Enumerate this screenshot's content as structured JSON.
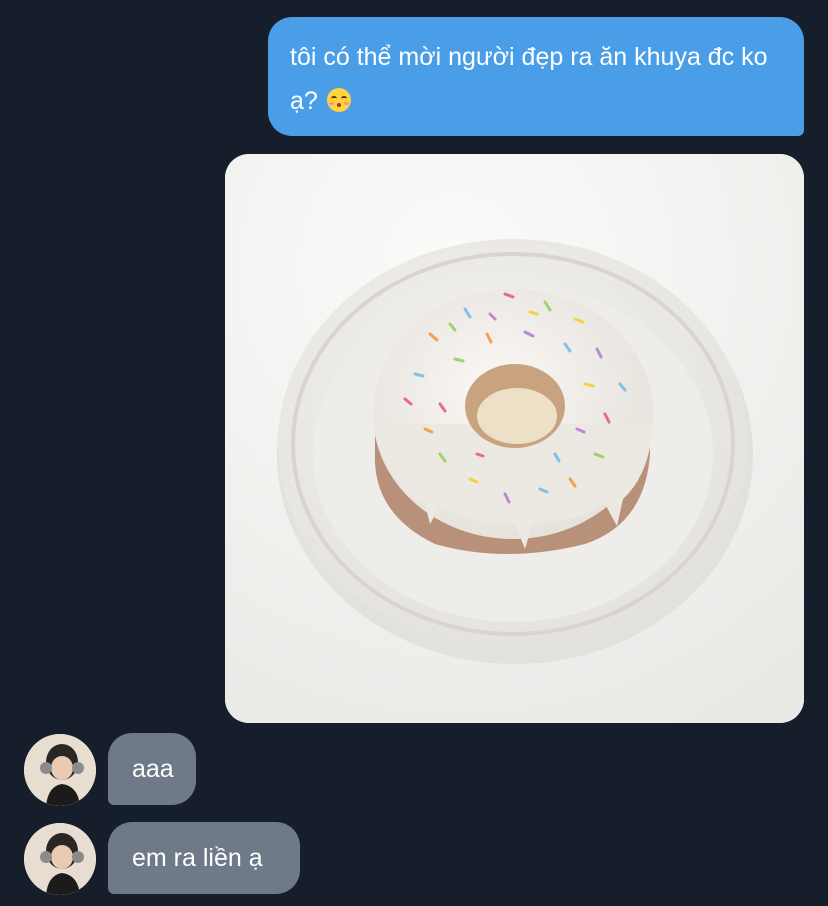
{
  "messages": {
    "outgoing_text": "tôi có thể mời người đẹp ra ăn khuya đc ko ạ?",
    "outgoing_emoji": "kissing-face-with-closed-eyes",
    "incoming": [
      {
        "text": "aaa"
      },
      {
        "text": "em ra liền ạ"
      }
    ]
  },
  "colors": {
    "background": "#151e2a",
    "outgoing_bubble": "#4a9ee8",
    "incoming_bubble": "#6e7a87"
  }
}
